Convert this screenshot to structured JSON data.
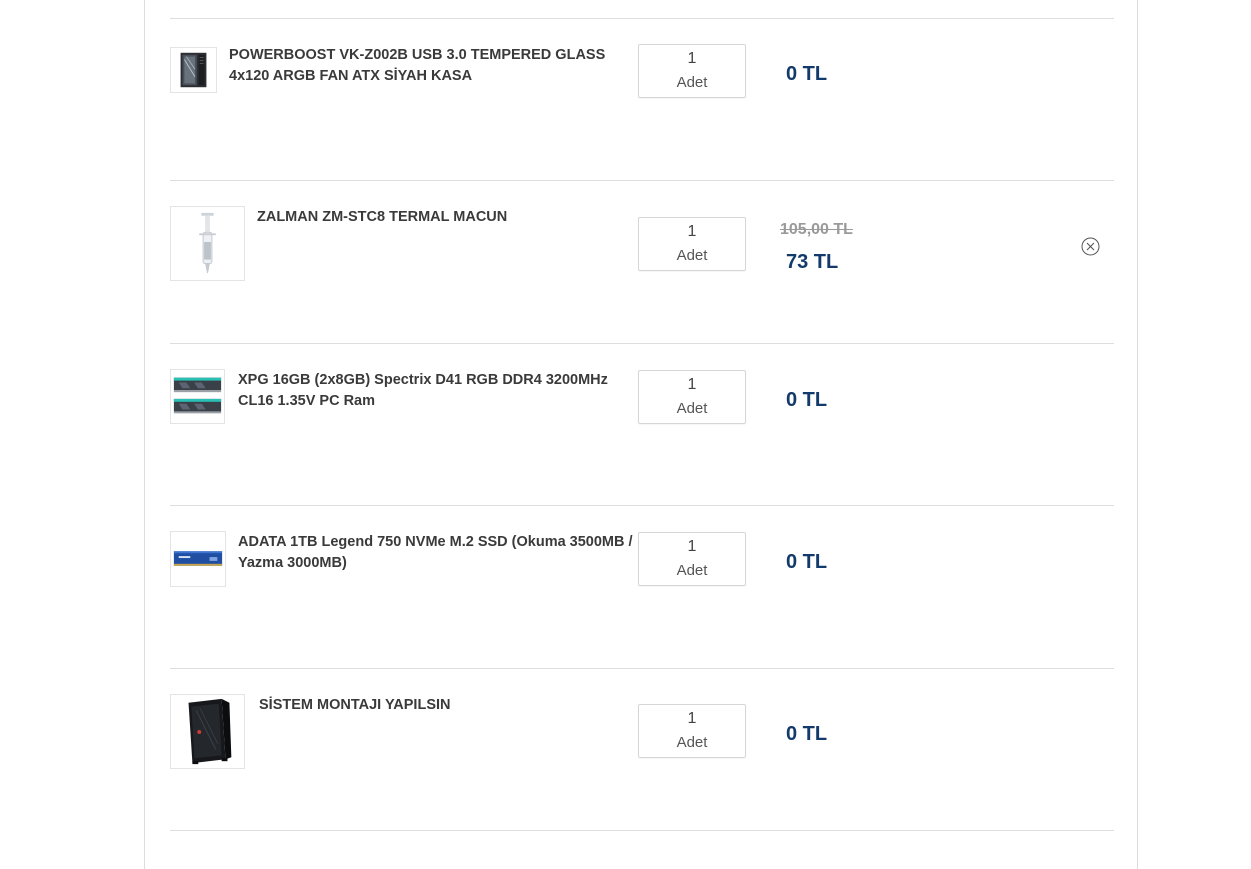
{
  "cart": {
    "items": [
      {
        "name": "POWERBOOST VK-Z002B USB 3.0 TEMPERED GLASS 4x120 ARGB FAN ATX SİYAH KASA",
        "quantity": "1",
        "unit": "Adet",
        "price": "0 TL",
        "image_icon": "pc-case-icon"
      },
      {
        "name": "ZALMAN ZM-STC8 TERMAL MACUN",
        "quantity": "1",
        "unit": "Adet",
        "old_price": "105,00 TL",
        "price": "73 TL",
        "image_icon": "thermal-paste-syringe-icon",
        "remove_icon": "close-circle-icon"
      },
      {
        "name": "XPG 16GB (2x8GB) Spectrix D41 RGB DDR4 3200MHz CL16 1.35V PC Ram",
        "quantity": "1",
        "unit": "Adet",
        "price": "0 TL",
        "image_icon": "ram-modules-icon"
      },
      {
        "name": "ADATA 1TB Legend 750 NVMe M.2 SSD (Okuma 3500MB / Yazma 3000MB)",
        "quantity": "1",
        "unit": "Adet",
        "price": "0 TL",
        "image_icon": "ssd-icon"
      },
      {
        "name": "SİSTEM MONTAJI YAPILSIN",
        "quantity": "1",
        "unit": "Adet",
        "price": "0 TL",
        "image_icon": "pc-case-icon"
      }
    ]
  },
  "colors": {
    "price": "#123a6b",
    "old_price": "#9a9a9a",
    "divider": "#dedede"
  }
}
